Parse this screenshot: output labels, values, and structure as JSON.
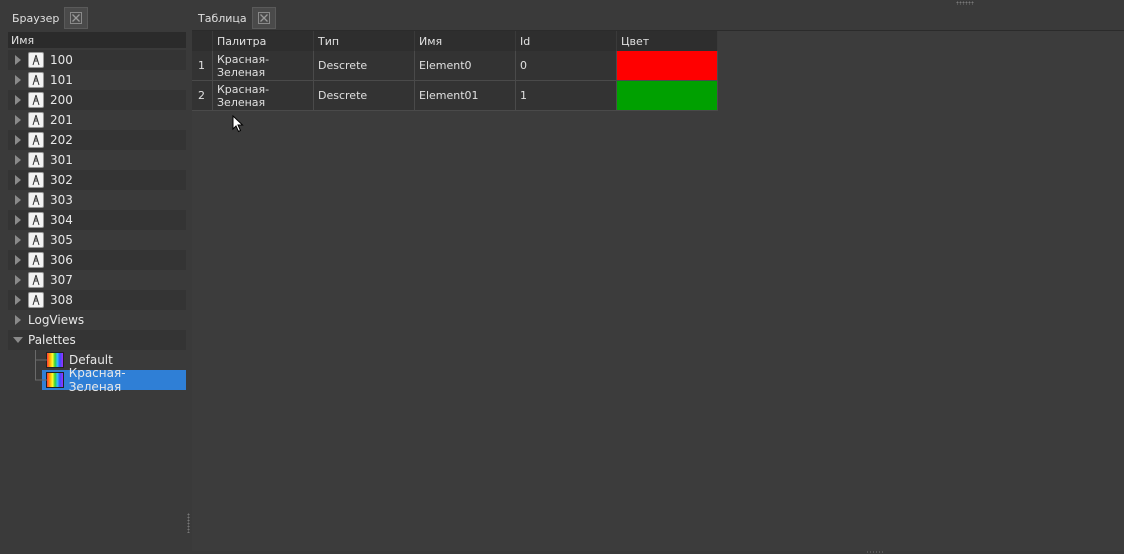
{
  "browser": {
    "title": "Браузер",
    "column_header": "Имя",
    "items": [
      {
        "label": "100",
        "icon": "well-icon"
      },
      {
        "label": "101",
        "icon": "well-icon"
      },
      {
        "label": "200",
        "icon": "well-icon"
      },
      {
        "label": "201",
        "icon": "well-icon"
      },
      {
        "label": "202",
        "icon": "well-icon"
      },
      {
        "label": "301",
        "icon": "well-icon"
      },
      {
        "label": "302",
        "icon": "well-icon"
      },
      {
        "label": "303",
        "icon": "well-icon"
      },
      {
        "label": "304",
        "icon": "well-icon"
      },
      {
        "label": "305",
        "icon": "well-icon"
      },
      {
        "label": "306",
        "icon": "well-icon"
      },
      {
        "label": "307",
        "icon": "well-icon"
      },
      {
        "label": "308",
        "icon": "well-icon"
      },
      {
        "label": "LogViews"
      },
      {
        "label": "Palettes",
        "expanded": true
      }
    ],
    "palettes": [
      {
        "label": "Default",
        "selected": false
      },
      {
        "label": "Красная-Зеленая",
        "selected": true
      }
    ]
  },
  "table": {
    "title": "Таблица",
    "columns": [
      "Палитра",
      "Тип",
      "Имя",
      "Id",
      "Цвет"
    ],
    "rows": [
      {
        "num": "1",
        "palette": "Красная-Зеленая",
        "type": "Descrete",
        "name": "Element0",
        "id": "0",
        "color": "#ff0000"
      },
      {
        "num": "2",
        "palette": "Красная-Зеленая",
        "type": "Descrete",
        "name": "Element01",
        "id": "1",
        "color": "#00a000"
      }
    ]
  }
}
